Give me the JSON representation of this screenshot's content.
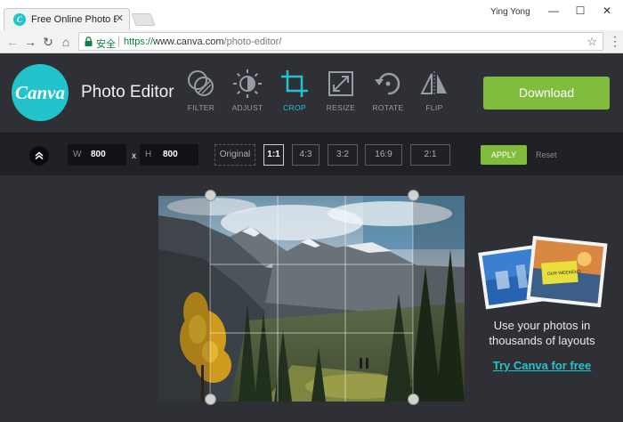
{
  "browser": {
    "tab_title": "Free Online Photo Edito",
    "tab_close": "✕",
    "user_name": "Ying Yong",
    "minimize_glyph": "—",
    "maximize_glyph": "☐",
    "close_glyph": "✕",
    "secure_label": "安全",
    "url_scheme": "https://",
    "url_host": "www.canva.com",
    "url_path": "/photo-editor/"
  },
  "app": {
    "logo_text": "Canva",
    "title": "Photo Editor",
    "download_label": "Download",
    "tools": [
      {
        "label": "FILTER",
        "icon": "filter-icon"
      },
      {
        "label": "ADJUST",
        "icon": "adjust-icon"
      },
      {
        "label": "CROP",
        "icon": "crop-icon",
        "active": true
      },
      {
        "label": "RESIZE",
        "icon": "resize-icon"
      },
      {
        "label": "ROTATE",
        "icon": "rotate-icon"
      },
      {
        "label": "FLIP",
        "icon": "flip-icon"
      }
    ]
  },
  "crop": {
    "width_label": "W",
    "width_value": "800",
    "times": "x",
    "height_label": "H",
    "height_value": "800",
    "ratios": [
      "Original",
      "1:1",
      "4:3",
      "3:2",
      "16:9",
      "2:1"
    ],
    "active_ratio": "1:1",
    "apply_label": "APPLY",
    "reset_label": "Reset"
  },
  "promo": {
    "line1": "Use your photos in",
    "line2": "thousands of layouts",
    "link": "Try Canva for free",
    "card_text": "OUR WEEKEND"
  },
  "colors": {
    "accent": "#23c3cc",
    "green": "#80bd3d",
    "header_bg": "#2f3036",
    "bar_bg": "#202126"
  }
}
